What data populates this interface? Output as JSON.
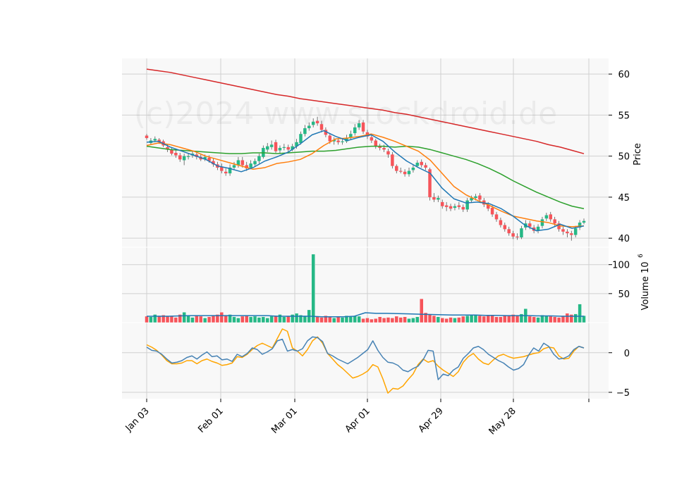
{
  "chart_data": {
    "type": "candlestick",
    "watermark": "(c)2024 www.stockdroid.de",
    "date_ticks": [
      "Jan 03",
      "Feb 01",
      "Mar 01",
      "Apr 01",
      "Apr 29",
      "May 28"
    ],
    "colors": {
      "up": "#26b886",
      "down": "#f6545a",
      "ma200": "#d62728",
      "ma50": "#2ca02c",
      "ma20": "#ff7f0e",
      "ma10": "#1f77b4",
      "osc_fast": "#4682b4",
      "osc_slow": "#ffa500",
      "vol_avg": "#1f77b4",
      "panel_bg": "#f8f8f8",
      "grid": "#d0d0d0"
    },
    "panels": {
      "price": {
        "ylabel": "Price",
        "ylim": [
          38.9,
          61.9
        ],
        "yticks": [
          40,
          45,
          50,
          55,
          60
        ],
        "candles": [
          [
            52.5,
            52.2,
            52.7,
            52.0
          ],
          [
            51.6,
            51.9,
            52.2,
            51.4
          ],
          [
            51.9,
            52.1,
            52.4,
            51.7
          ],
          [
            52.0,
            51.7,
            52.2,
            51.5
          ],
          [
            51.8,
            51.3,
            52.0,
            51.1
          ],
          [
            51.1,
            50.8,
            51.4,
            50.5
          ],
          [
            50.8,
            50.3,
            51.0,
            50.1
          ],
          [
            50.4,
            50.1,
            50.7,
            49.8
          ],
          [
            50.1,
            49.6,
            50.4,
            49.3
          ],
          [
            49.5,
            50.0,
            50.3,
            48.9
          ],
          [
            49.9,
            50.0,
            50.4,
            49.6
          ],
          [
            50.1,
            50.3,
            50.6,
            49.8
          ],
          [
            50.2,
            49.9,
            50.5,
            49.6
          ],
          [
            49.9,
            49.6,
            50.3,
            49.4
          ],
          [
            49.6,
            49.9,
            50.2,
            49.4
          ],
          [
            49.8,
            49.4,
            50.1,
            49.2
          ],
          [
            49.4,
            49.0,
            49.8,
            48.7
          ],
          [
            49.0,
            48.6,
            49.3,
            48.3
          ],
          [
            48.7,
            48.2,
            49.1,
            47.9
          ],
          [
            48.1,
            47.9,
            48.5,
            47.6
          ],
          [
            47.9,
            48.6,
            49.0,
            47.6
          ],
          [
            48.6,
            48.9,
            49.3,
            48.3
          ],
          [
            48.9,
            49.5,
            49.9,
            48.6
          ],
          [
            49.5,
            48.9,
            49.9,
            48.6
          ],
          [
            48.9,
            48.5,
            49.3,
            48.2
          ],
          [
            48.6,
            49.1,
            49.5,
            48.4
          ],
          [
            49.0,
            49.4,
            49.7,
            48.8
          ],
          [
            49.4,
            50.0,
            50.3,
            49.1
          ],
          [
            49.9,
            51.0,
            51.3,
            49.7
          ],
          [
            50.8,
            51.2,
            51.6,
            50.5
          ],
          [
            51.1,
            51.4,
            51.9,
            50.8
          ],
          [
            51.7,
            50.6,
            52.0,
            50.4
          ],
          [
            50.7,
            51.0,
            51.3,
            50.4
          ],
          [
            51.0,
            51.1,
            51.5,
            50.7
          ],
          [
            51.1,
            50.8,
            51.4,
            50.5
          ],
          [
            50.8,
            51.2,
            51.5,
            50.6
          ],
          [
            51.2,
            51.7,
            52.1,
            50.9
          ],
          [
            51.6,
            52.7,
            53.0,
            51.4
          ],
          [
            52.7,
            53.4,
            53.8,
            52.4
          ],
          [
            53.4,
            53.7,
            54.1,
            53.1
          ],
          [
            53.8,
            54.2,
            54.6,
            53.5
          ],
          [
            54.3,
            54.0,
            54.8,
            53.7
          ],
          [
            53.9,
            53.2,
            54.3,
            52.9
          ],
          [
            53.2,
            52.6,
            53.5,
            52.3
          ],
          [
            52.5,
            51.8,
            52.8,
            51.5
          ],
          [
            51.8,
            52.0,
            52.3,
            51.4
          ],
          [
            51.9,
            51.7,
            52.2,
            51.4
          ],
          [
            51.7,
            51.8,
            52.1,
            51.4
          ],
          [
            51.8,
            52.2,
            52.6,
            51.6
          ],
          [
            52.3,
            52.7,
            53.1,
            52.0
          ],
          [
            52.8,
            53.5,
            53.9,
            52.5
          ],
          [
            53.5,
            54.0,
            54.4,
            53.2
          ],
          [
            54.1,
            53.0,
            54.4,
            52.7
          ],
          [
            52.9,
            52.4,
            53.2,
            52.1
          ],
          [
            52.3,
            51.9,
            52.6,
            51.6
          ],
          [
            51.9,
            51.2,
            52.1,
            50.9
          ],
          [
            51.2,
            51.0,
            51.5,
            50.7
          ],
          [
            51.0,
            50.8,
            51.4,
            50.5
          ],
          [
            50.6,
            50.2,
            50.9,
            49.8
          ],
          [
            50.2,
            48.8,
            50.5,
            48.5
          ],
          [
            48.8,
            48.2,
            49.0,
            47.9
          ],
          [
            48.2,
            48.1,
            48.6,
            47.9
          ],
          [
            48.1,
            47.8,
            48.4,
            47.5
          ],
          [
            47.8,
            48.2,
            48.6,
            47.5
          ],
          [
            48.3,
            48.6,
            48.9,
            48.0
          ],
          [
            48.8,
            49.2,
            49.5,
            48.6
          ],
          [
            49.3,
            48.9,
            49.6,
            48.6
          ],
          [
            48.9,
            48.6,
            49.2,
            48.3
          ],
          [
            48.4,
            45.0,
            48.6,
            44.6
          ],
          [
            45.0,
            44.7,
            45.5,
            44.4
          ],
          [
            44.7,
            44.9,
            45.2,
            44.4
          ],
          [
            44.4,
            43.9,
            44.7,
            43.6
          ],
          [
            44.0,
            43.8,
            44.4,
            43.3
          ],
          [
            43.9,
            43.6,
            44.2,
            43.3
          ],
          [
            43.7,
            43.9,
            44.2,
            43.4
          ],
          [
            44.0,
            43.8,
            44.4,
            43.5
          ],
          [
            43.8,
            43.5,
            44.1,
            43.2
          ],
          [
            43.5,
            44.6,
            44.9,
            43.2
          ],
          [
            44.6,
            44.9,
            45.2,
            44.3
          ],
          [
            44.9,
            45.1,
            45.4,
            44.6
          ],
          [
            45.2,
            44.7,
            45.5,
            44.4
          ],
          [
            44.6,
            44.1,
            44.9,
            43.8
          ],
          [
            44.1,
            43.6,
            44.4,
            43.3
          ],
          [
            43.7,
            42.9,
            44.0,
            42.6
          ],
          [
            42.9,
            42.3,
            43.2,
            42.0
          ],
          [
            42.2,
            41.6,
            42.5,
            41.3
          ],
          [
            41.6,
            41.1,
            41.9,
            40.8
          ],
          [
            41.1,
            40.6,
            41.4,
            40.3
          ],
          [
            40.6,
            40.2,
            40.9,
            39.9
          ],
          [
            40.2,
            40.1,
            40.6,
            39.8
          ],
          [
            40.1,
            41.2,
            41.5,
            39.9
          ],
          [
            41.3,
            41.8,
            42.2,
            41.0
          ],
          [
            41.8,
            41.4,
            42.1,
            41.1
          ],
          [
            41.3,
            40.9,
            41.6,
            40.6
          ],
          [
            40.9,
            41.4,
            41.7,
            40.6
          ],
          [
            41.5,
            42.3,
            42.6,
            41.2
          ],
          [
            42.4,
            42.8,
            43.1,
            42.1
          ],
          [
            42.9,
            42.3,
            43.2,
            42.0
          ],
          [
            42.3,
            41.8,
            42.6,
            41.5
          ],
          [
            41.8,
            41.1,
            42.1,
            40.8
          ],
          [
            41.1,
            40.8,
            41.4,
            40.4
          ],
          [
            40.8,
            40.6,
            41.1,
            40.1
          ],
          [
            40.6,
            40.4,
            40.9,
            39.7
          ],
          [
            40.4,
            41.2,
            41.5,
            40.1
          ],
          [
            41.3,
            41.9,
            42.2,
            41.0
          ],
          [
            41.9,
            42.1,
            42.4,
            41.7
          ]
        ],
        "ma200": [
          60.6,
          60.4,
          60.2,
          59.9,
          59.6,
          59.3,
          59.0,
          58.7,
          58.4,
          58.1,
          57.8,
          57.5,
          57.3,
          57.0,
          56.8,
          56.6,
          56.4,
          56.2,
          56.0,
          55.8,
          55.6,
          55.3,
          55.1,
          54.8,
          54.5,
          54.2,
          53.9,
          53.6,
          53.3,
          53.0,
          52.7,
          52.4,
          52.1,
          51.8,
          51.4,
          51.1,
          50.7,
          50.3
        ],
        "ma50": [
          51.2,
          51.0,
          50.8,
          50.7,
          50.6,
          50.5,
          50.4,
          50.3,
          50.3,
          50.4,
          50.4,
          50.3,
          50.4,
          50.5,
          50.6,
          50.6,
          50.7,
          50.9,
          51.1,
          51.2,
          51.2,
          51.1,
          51.2,
          51.1,
          50.8,
          50.4,
          50.0,
          49.6,
          49.1,
          48.5,
          47.8,
          47.0,
          46.3,
          45.6,
          45.0,
          44.4,
          43.9,
          43.6
        ],
        "ma20": [
          51.3,
          51.6,
          51.4,
          51.0,
          50.6,
          50.0,
          49.6,
          49.2,
          48.8,
          48.4,
          48.6,
          49.1,
          49.3,
          49.6,
          50.3,
          51.3,
          52.1,
          52.2,
          52.4,
          52.7,
          52.3,
          51.8,
          51.2,
          50.6,
          49.5,
          47.9,
          46.3,
          45.3,
          44.6,
          44.0,
          43.3,
          42.7,
          42.4,
          42.1,
          41.9,
          41.5,
          41.4,
          41.5
        ],
        "ma10": [
          51.7,
          51.8,
          51.1,
          50.6,
          50.1,
          49.6,
          48.8,
          48.5,
          48.1,
          48.6,
          49.4,
          49.9,
          50.5,
          51.5,
          52.6,
          53.1,
          52.4,
          51.9,
          52.3,
          52.6,
          51.8,
          50.5,
          49.4,
          48.6,
          47.9,
          46.1,
          44.8,
          44.3,
          44.4,
          44.2,
          43.6,
          42.7,
          41.6,
          40.9,
          41.1,
          41.7,
          41.2,
          41.5
        ]
      },
      "volume": {
        "ylabel": "Volume  10",
        "ylabel_exp": "6",
        "ylim": [
          0,
          130
        ],
        "yticks": [
          50,
          100
        ],
        "values": [
          11,
          10,
          14,
          12,
          13,
          11,
          12,
          9,
          14,
          18,
          12,
          9,
          13,
          11,
          8,
          10,
          13,
          14,
          18,
          12,
          14,
          10,
          8,
          11,
          12,
          10,
          11,
          9,
          10,
          8,
          11,
          12,
          14,
          10,
          11,
          14,
          16,
          13,
          12,
          22,
          118,
          10,
          9,
          12,
          11,
          8,
          11,
          9,
          12,
          10,
          12,
          11,
          7,
          8,
          6,
          7,
          10,
          8,
          9,
          8,
          11,
          9,
          10,
          7,
          8,
          10,
          41,
          17,
          14,
          12,
          10,
          8,
          7,
          9,
          8,
          9,
          11,
          12,
          13,
          14,
          12,
          11,
          13,
          12,
          10,
          10,
          12,
          13,
          14,
          12,
          15,
          24,
          11,
          10,
          9,
          13,
          12,
          11,
          10,
          9,
          12,
          16,
          14,
          15,
          32,
          12
        ],
        "avg": [
          11,
          11,
          11,
          11.5,
          12,
          12,
          12,
          12,
          12,
          12,
          12,
          12,
          11,
          11,
          11,
          11,
          10,
          10,
          10,
          11,
          17,
          16,
          16,
          15.5,
          15,
          14.5,
          14,
          13.5,
          13,
          13,
          13,
          12.5,
          12.5,
          12,
          12,
          12,
          11.5,
          11.5,
          11,
          11,
          11
        ]
      },
      "oscillator": {
        "ylim": [
          -5.8,
          3.8
        ],
        "yticks": [
          -5,
          0
        ],
        "fast": [
          0.7,
          0.3,
          0.2,
          -0.2,
          -0.8,
          -1.3,
          -1.2,
          -1.0,
          -0.6,
          -0.4,
          -0.8,
          -0.3,
          0.1,
          -0.5,
          -0.4,
          -0.9,
          -0.8,
          -1.1,
          -0.2,
          -0.5,
          -0.1,
          0.6,
          0.4,
          -0.2,
          0.1,
          0.5,
          1.5,
          1.7,
          0.2,
          0.4,
          0.2,
          0.5,
          1.5,
          2.0,
          1.9,
          1.4,
          -0.1,
          -0.4,
          -0.8,
          -1.1,
          -1.4,
          -1.0,
          -0.6,
          -0.1,
          0.4,
          1.5,
          0.3,
          -0.6,
          -1.2,
          -1.3,
          -1.6,
          -2.2,
          -2.4,
          -2.0,
          -1.7,
          -0.9,
          0.3,
          0.2,
          -3.4,
          -2.7,
          -2.9,
          -2.2,
          -1.8,
          -0.7,
          -0.1,
          0.6,
          0.8,
          0.4,
          -0.2,
          -0.6,
          -1.0,
          -1.3,
          -1.8,
          -2.2,
          -2.0,
          -1.5,
          -0.3,
          0.6,
          0.2,
          1.2,
          0.8,
          -0.2,
          -0.8,
          -0.7,
          -0.4,
          0.4,
          0.8,
          0.6
        ],
        "slow": [
          1.0,
          0.7,
          0.3,
          -0.3,
          -1.0,
          -1.4,
          -1.4,
          -1.3,
          -1.0,
          -1.0,
          -1.4,
          -1.0,
          -0.8,
          -1.1,
          -1.3,
          -1.6,
          -1.5,
          -1.3,
          -0.5,
          -0.6,
          -0.2,
          0.4,
          0.9,
          1.2,
          0.9,
          0.6,
          1.8,
          3.0,
          2.7,
          0.6,
          0.2,
          -0.4,
          0.4,
          1.5,
          2.0,
          1.2,
          -0.1,
          -0.8,
          -1.5,
          -2.0,
          -2.6,
          -3.2,
          -3.0,
          -2.7,
          -2.3,
          -1.5,
          -1.8,
          -3.3,
          -5.1,
          -4.5,
          -4.6,
          -4.2,
          -3.4,
          -2.7,
          -1.5,
          -0.8,
          -1.2,
          -1.0,
          -1.7,
          -2.2,
          -2.6,
          -3.0,
          -2.4,
          -1.2,
          -0.5,
          -0.1,
          -0.8,
          -1.3,
          -1.5,
          -0.9,
          -0.4,
          -0.2,
          -0.5,
          -0.7,
          -0.6,
          -0.5,
          -0.3,
          -0.1,
          0.0,
          0.5,
          0.7,
          0.6,
          -0.4,
          -0.8,
          -0.7,
          0.2,
          0.8,
          0.6
        ]
      }
    }
  }
}
